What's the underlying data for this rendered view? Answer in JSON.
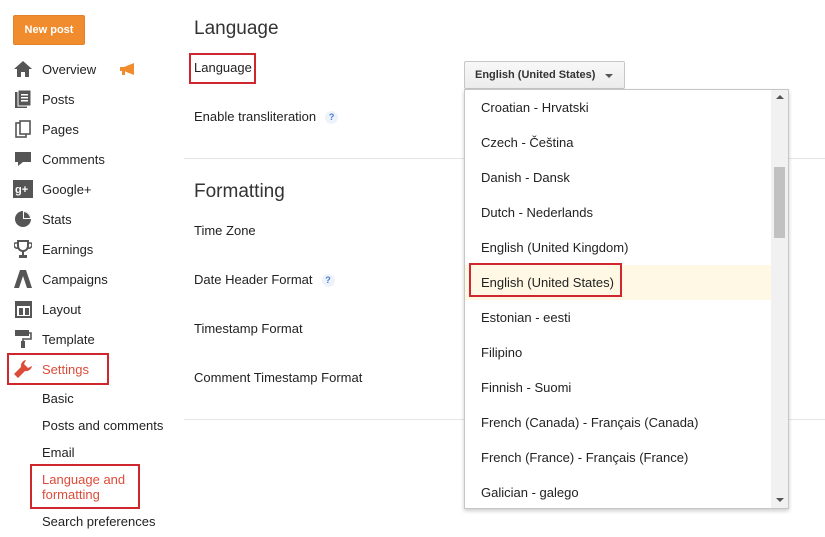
{
  "sidebar": {
    "new_post_label": "New post",
    "items": [
      {
        "label": "Overview",
        "icon": "home-icon"
      },
      {
        "label": "Posts",
        "icon": "posts-icon"
      },
      {
        "label": "Pages",
        "icon": "pages-icon"
      },
      {
        "label": "Comments",
        "icon": "comments-icon"
      },
      {
        "label": "Google+",
        "icon": "google-plus-icon"
      },
      {
        "label": "Stats",
        "icon": "stats-icon"
      },
      {
        "label": "Earnings",
        "icon": "trophy-icon"
      },
      {
        "label": "Campaigns",
        "icon": "campaigns-icon"
      },
      {
        "label": "Layout",
        "icon": "layout-icon"
      },
      {
        "label": "Template",
        "icon": "paint-roller-icon"
      },
      {
        "label": "Settings",
        "icon": "wrench-icon",
        "active": true
      }
    ],
    "settings_subitems": [
      {
        "label": "Basic"
      },
      {
        "label": "Posts and comments"
      },
      {
        "label": "Email"
      },
      {
        "label": "Language and formatting",
        "active": true
      },
      {
        "label": "Search preferences"
      }
    ],
    "colors": {
      "accent": "#dd4b39",
      "button": "#f08c2e"
    }
  },
  "main": {
    "language_section": {
      "title": "Language",
      "language_label": "Language",
      "selected_language": "English (United States)",
      "transliteration_label": "Enable transliteration",
      "help_glyph": "?"
    },
    "formatting_section": {
      "title": "Formatting",
      "time_zone_label": "Time Zone",
      "date_header_label": "Date Header Format",
      "timestamp_label": "Timestamp Format",
      "comment_timestamp_label": "Comment Timestamp Format",
      "help_glyph": "?"
    }
  },
  "dropdown": {
    "options": [
      "Croatian - Hrvatski",
      "Czech - Čeština",
      "Danish - Dansk",
      "Dutch - Nederlands",
      "English (United Kingdom)",
      "English (United States)",
      "Estonian - eesti",
      "Filipino",
      "Finnish - Suomi",
      "French (Canada) - Français (Canada)",
      "French (France) - Français (France)",
      "Galician - galego"
    ],
    "selected_index": 5,
    "selected_bg": "#fff8e5"
  }
}
